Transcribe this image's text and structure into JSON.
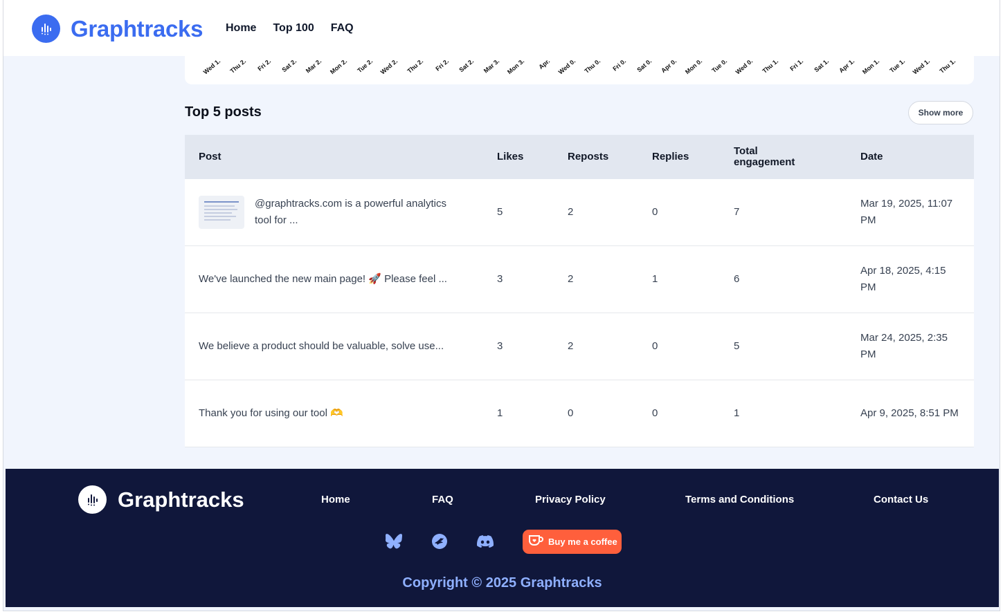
{
  "header": {
    "brand": "Graphtracks",
    "nav": [
      {
        "label": "Home"
      },
      {
        "label": "Top 100"
      },
      {
        "label": "FAQ"
      }
    ]
  },
  "chart_tail": {
    "x_ticks": [
      "Wed 1.",
      "Thu 2.",
      "Fri 2.",
      "Sat 2.",
      "Mar 2.",
      "Mon 2.",
      "Tue 2.",
      "Wed 2.",
      "Thu 2.",
      "Fri 2.",
      "Sat 2.",
      "Mar 3.",
      "Mon 3.",
      "Apr.",
      "Wed 0.",
      "Thu 0.",
      "Fri 0.",
      "Sat 0.",
      "Apr 0.",
      "Mon 0.",
      "Tue 0.",
      "Wed 0.",
      "Thu 1.",
      "Fri 1.",
      "Sat 1.",
      "Apr 1.",
      "Mon 1.",
      "Tue 1.",
      "Wed 1.",
      "Thu 1."
    ]
  },
  "top_posts": {
    "title": "Top 5 posts",
    "show_more": "Show more",
    "columns": {
      "post": "Post",
      "likes": "Likes",
      "reposts": "Reposts",
      "replies": "Replies",
      "total_line1": "Total",
      "total_line2": "engagement",
      "date": "Date"
    },
    "rows": [
      {
        "post": "@graphtracks.com is a powerful analytics tool for ...",
        "likes": "5",
        "reposts": "2",
        "replies": "0",
        "total": "7",
        "date": "Mar 19, 2025, 11:07 PM",
        "has_thumb": true
      },
      {
        "post": "We've launched the new main page! 🚀 Please feel ...",
        "likes": "3",
        "reposts": "2",
        "replies": "1",
        "total": "6",
        "date": "Apr 18, 2025, 4:15 PM",
        "has_thumb": false
      },
      {
        "post": "We believe a product should be valuable, solve use...",
        "likes": "3",
        "reposts": "2",
        "replies": "0",
        "total": "5",
        "date": "Mar 24, 2025, 2:35 PM",
        "has_thumb": false
      },
      {
        "post": "Thank you for using our tool 🫶",
        "likes": "1",
        "reposts": "0",
        "replies": "0",
        "total": "1",
        "date": "Apr 9, 2025, 8:51 PM",
        "has_thumb": false
      }
    ]
  },
  "footer": {
    "brand": "Graphtracks",
    "links": {
      "home": "Home",
      "faq": "FAQ",
      "privacy": "Privacy Policy",
      "terms": "Terms and Conditions",
      "contact": "Contact Us"
    },
    "social": [
      "bluesky-icon",
      "threads-bird-icon",
      "discord-icon"
    ],
    "coffee_label": "Buy me a coffee",
    "copyright": "Copyright © 2025 Graphtracks"
  },
  "colors": {
    "brand": "#3b6cf0",
    "footer_bg": "#10173b",
    "coffee": "#ff5f3c",
    "copyright": "#8fb0ff"
  }
}
